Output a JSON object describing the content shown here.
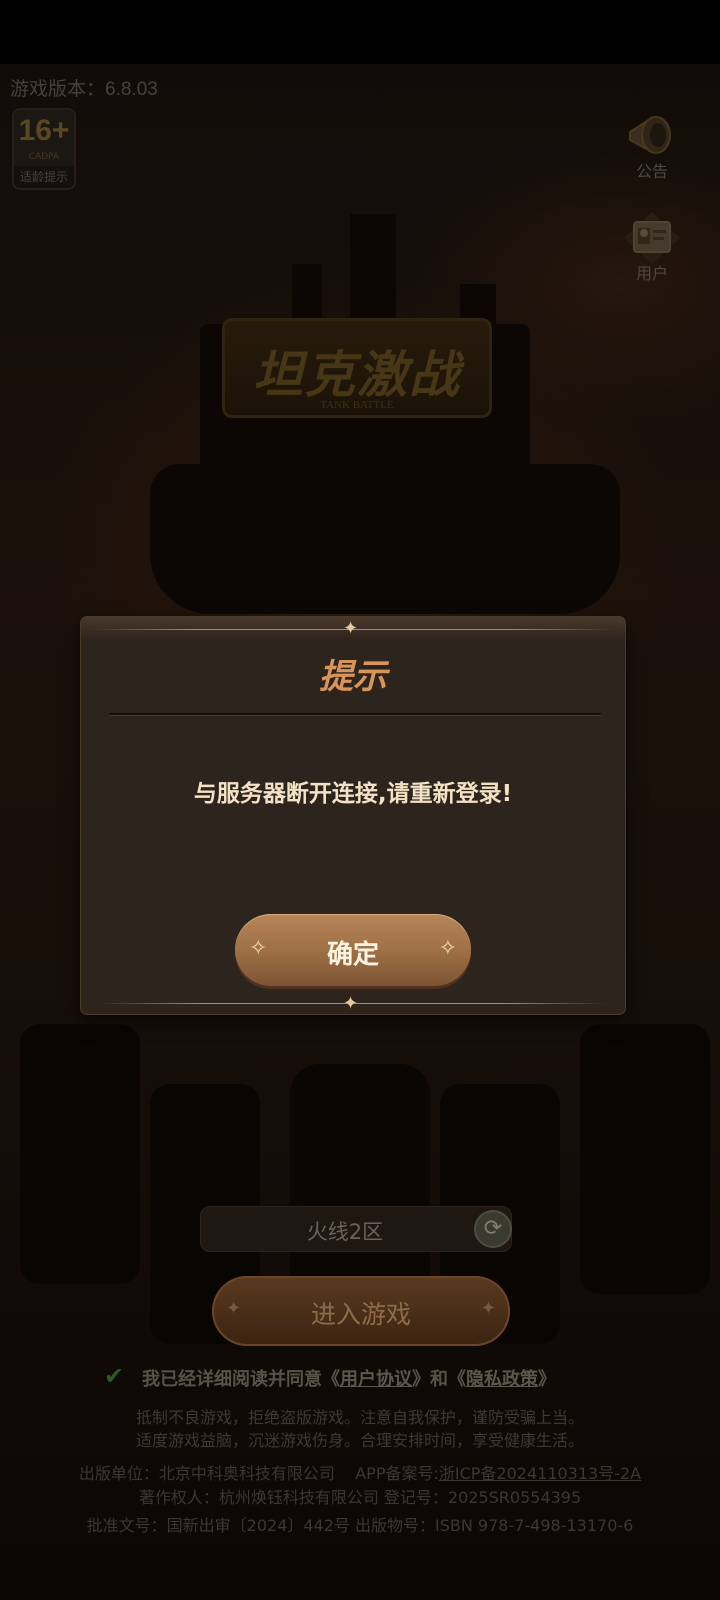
{
  "version_text": "游戏版本：6.8.03",
  "age_badge": {
    "number": "16+",
    "sub": "CADPA",
    "label": "适龄提示"
  },
  "side_buttons": {
    "notice": "公告",
    "user": "用户"
  },
  "logo": {
    "title": "坦克激战",
    "subtitle": "TANK BATTLE"
  },
  "dialog": {
    "title": "提示",
    "message": "与服务器断开连接,请重新登录!",
    "ok_label": "确定"
  },
  "server": {
    "name": "火线2区"
  },
  "enter_game_label": "进入游戏",
  "agreement": {
    "prefix": "我已经详细阅读并同意《",
    "user_agreement": "用户协议",
    "middle": "》和《",
    "privacy_policy": "隐私政策",
    "suffix": "》"
  },
  "footer": {
    "health_line1": "抵制不良游戏，拒绝盗版游戏。注意自我保护，谨防受骗上当。",
    "health_line2": "适度游戏益脑，沉迷游戏伤身。合理安排时间，享受健康生活。",
    "publisher": "出版单位：北京中科奥科技有限公司",
    "app_record_label": "APP备案号:",
    "app_record_value": "浙ICP备2024110313号-2A",
    "copyright": "著作权人：杭州焕钰科技有限公司 登记号：2025SR0554395",
    "approval": "批准文号：国新出审〔2024〕442号 出版物号：ISBN 978-7-498-13170-6"
  },
  "colors": {
    "accent": "#d8955a",
    "button": "#9d6e44",
    "dialog_bg": "#2e241e"
  }
}
